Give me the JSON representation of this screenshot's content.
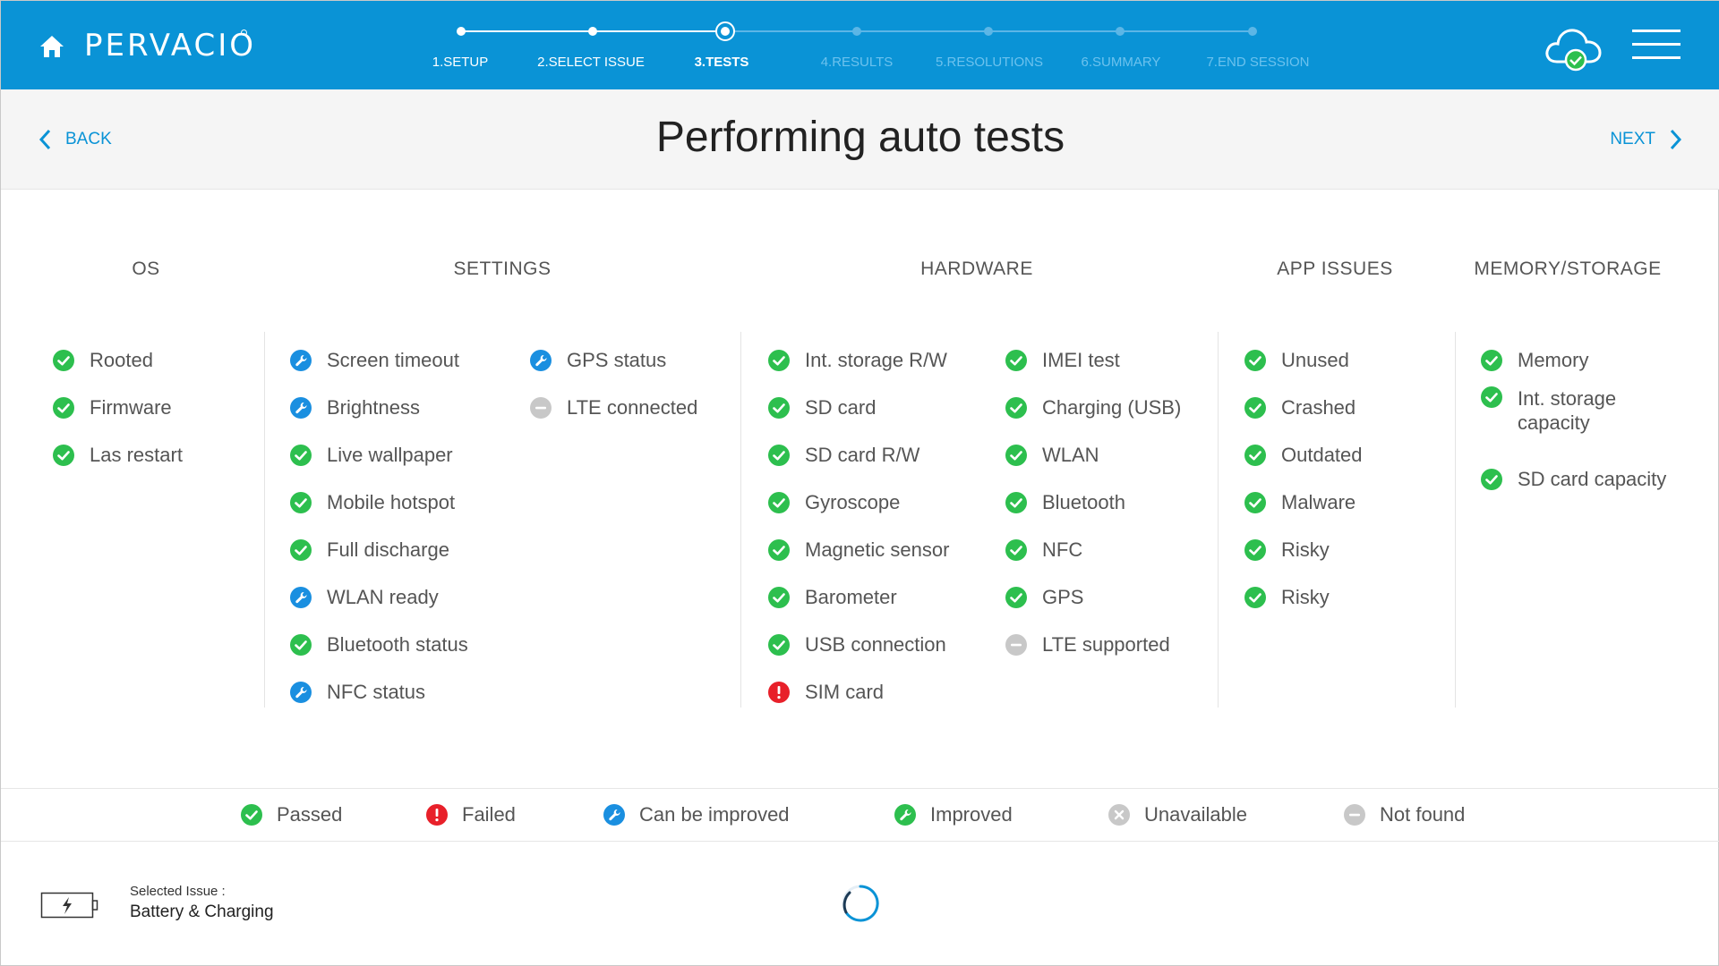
{
  "header": {
    "logo_text": "PERVACIO",
    "brand_color": "#0a93d6",
    "steps": [
      {
        "label": "1.SETUP",
        "state": "done"
      },
      {
        "label": "2.SELECT ISSUE",
        "state": "done"
      },
      {
        "label": "3.TESTS",
        "state": "current"
      },
      {
        "label": "4.RESULTS",
        "state": "future"
      },
      {
        "label": "5.RESOLUTIONS",
        "state": "future"
      },
      {
        "label": "6.SUMMARY",
        "state": "future"
      },
      {
        "label": "7.END SESSION",
        "state": "future"
      }
    ],
    "icons": [
      "home-icon",
      "cloud-check-icon",
      "hamburger-menu-icon"
    ]
  },
  "titlebar": {
    "back_label": "BACK",
    "title": "Performing auto tests",
    "next_label": "NEXT"
  },
  "status_colors": {
    "passed": "#2dbf4e",
    "failed": "#e8202a",
    "can_be_improved": "#1a8fe0",
    "improved": "#2dbf4e",
    "unavailable": "#c8c8c8",
    "not_found": "#c8c8c8"
  },
  "categories": {
    "os": {
      "title": "OS",
      "columns": [
        [
          {
            "label": "Rooted",
            "status": "passed"
          },
          {
            "label": "Firmware",
            "status": "passed"
          },
          {
            "label": "Las restart",
            "status": "passed"
          }
        ]
      ]
    },
    "settings": {
      "title": "SETTINGS",
      "columns": [
        [
          {
            "label": "Screen timeout",
            "status": "can_be_improved"
          },
          {
            "label": "Brightness",
            "status": "can_be_improved"
          },
          {
            "label": "Live wallpaper",
            "status": "passed"
          },
          {
            "label": "Mobile hotspot",
            "status": "passed"
          },
          {
            "label": "Full discharge",
            "status": "passed"
          },
          {
            "label": "WLAN ready",
            "status": "can_be_improved"
          },
          {
            "label": "Bluetooth status",
            "status": "passed"
          },
          {
            "label": "NFC status",
            "status": "can_be_improved"
          }
        ],
        [
          {
            "label": "GPS status",
            "status": "can_be_improved"
          },
          {
            "label": "LTE connected",
            "status": "not_found"
          }
        ]
      ]
    },
    "hardware": {
      "title": "HARDWARE",
      "columns": [
        [
          {
            "label": "Int. storage R/W",
            "status": "passed"
          },
          {
            "label": "SD card",
            "status": "passed"
          },
          {
            "label": "SD card R/W",
            "status": "passed"
          },
          {
            "label": "Gyroscope",
            "status": "passed"
          },
          {
            "label": "Magnetic sensor",
            "status": "passed"
          },
          {
            "label": "Barometer",
            "status": "passed"
          },
          {
            "label": "USB connection",
            "status": "passed"
          },
          {
            "label": "SIM card",
            "status": "failed"
          }
        ],
        [
          {
            "label": "IMEI test",
            "status": "passed"
          },
          {
            "label": "Charging (USB)",
            "status": "passed"
          },
          {
            "label": "WLAN",
            "status": "passed"
          },
          {
            "label": "Bluetooth",
            "status": "passed"
          },
          {
            "label": "NFC",
            "status": "passed"
          },
          {
            "label": "GPS",
            "status": "passed"
          },
          {
            "label": "LTE supported",
            "status": "not_found"
          }
        ]
      ]
    },
    "app_issues": {
      "title": "APP ISSUES",
      "columns": [
        [
          {
            "label": "Unused",
            "status": "passed"
          },
          {
            "label": "Crashed",
            "status": "passed"
          },
          {
            "label": "Outdated",
            "status": "passed"
          },
          {
            "label": "Malware",
            "status": "passed"
          },
          {
            "label": "Risky",
            "status": "passed"
          },
          {
            "label": "Risky",
            "status": "passed"
          }
        ]
      ]
    },
    "memory": {
      "title": "MEMORY/STORAGE",
      "columns": [
        [
          {
            "label": "Memory",
            "status": "passed"
          },
          {
            "label": "Int. storage capacity",
            "status": "passed",
            "wrap": true
          },
          {
            "label": "SD card capacity",
            "status": "passed"
          }
        ]
      ]
    }
  },
  "legend": [
    {
      "label": "Passed",
      "status": "passed"
    },
    {
      "label": "Failed",
      "status": "failed"
    },
    {
      "label": "Can be improved",
      "status": "can_be_improved"
    },
    {
      "label": "Improved",
      "status": "improved"
    },
    {
      "label": "Unavailable",
      "status": "unavailable"
    },
    {
      "label": "Not found",
      "status": "not_found"
    }
  ],
  "footer": {
    "selected_caption": "Selected Issue :",
    "selected_value": "Battery & Charging",
    "icons": [
      "battery-charging-icon",
      "loading-spinner-icon"
    ]
  }
}
